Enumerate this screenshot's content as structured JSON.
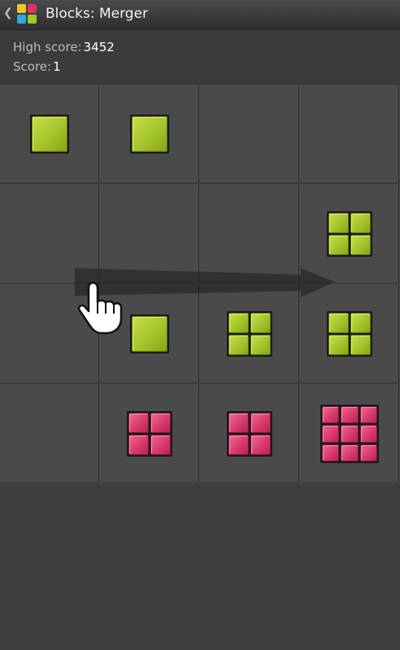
{
  "header": {
    "back_icon": "chevron-left-icon",
    "app_icon": "blocks-app-icon",
    "title": "Blocks: Merger"
  },
  "scores": {
    "high_score_label": "High score:",
    "high_score_value": "3452",
    "score_label": "Score:",
    "score_value": "1"
  },
  "board": {
    "size": 4,
    "blocks": [
      {
        "row": 0,
        "col": 0,
        "color": "green",
        "level": 1
      },
      {
        "row": 0,
        "col": 1,
        "color": "green",
        "level": 1
      },
      {
        "row": 1,
        "col": 3,
        "color": "green",
        "level": 2
      },
      {
        "row": 2,
        "col": 1,
        "color": "green",
        "level": 1
      },
      {
        "row": 2,
        "col": 2,
        "color": "green",
        "level": 2
      },
      {
        "row": 2,
        "col": 3,
        "color": "green",
        "level": 2
      },
      {
        "row": 3,
        "col": 1,
        "color": "pink",
        "level": 2
      },
      {
        "row": 3,
        "col": 2,
        "color": "pink",
        "level": 2
      },
      {
        "row": 3,
        "col": 3,
        "color": "pink",
        "level": 3
      }
    ]
  },
  "tutorial": {
    "gesture": "swipe-right",
    "icons": [
      "arrow-right-icon",
      "hand-pointer-icon"
    ]
  },
  "colors": {
    "green": "#a4c42a",
    "pink": "#d93a6a",
    "background": "#3d3d3d"
  }
}
